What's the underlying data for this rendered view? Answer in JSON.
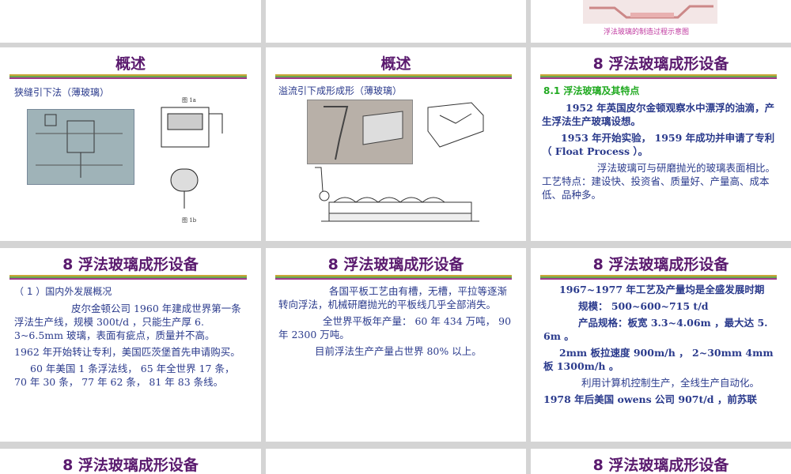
{
  "top_caption": "浮法玻璃的制造过程示意图",
  "slides": {
    "s1": {
      "title": "概述",
      "subtitle": "狭缝引下法（薄玻璃）",
      "fig_a": "图 1a",
      "fig_b": "图 1b"
    },
    "s2": {
      "title": "概述",
      "subtitle": "溢流引下成形成形（薄玻璃）"
    },
    "s3": {
      "title": "8  浮法玻璃成形设备",
      "heading": "8.1   浮法玻璃及其特点",
      "p1": "1952 年英国皮尔金顿观察水中漂浮的油滴，产生浮法生产玻璃设想。",
      "p2": "1953 年开始实验， 1959 年成功并申请了专利（ Float Process ）。",
      "p3": "浮法玻璃可与研磨抛光的玻璃表面相比。工艺特点：建设快、投资省、质量好、产量高、成本低、品种多。"
    },
    "s4": {
      "title": "8  浮法玻璃成形设备",
      "heading": "（ 1 ）国内外发展概况",
      "p1": "皮尔金顿公司 1960 年建成世界第一条浮法生产线，规模 300t/d ，只能生产厚 6. 3~6.5mm 玻璃，表面有疵点，质量并不高。",
      "p2": "1962 年开始转让专利，美国匹茨堡首先申请购买。",
      "p3": "60 年美国 1 条浮法线， 65 年全世界 17 条， 70 年 30 条， 77 年 62 条， 81 年 83 条线。"
    },
    "s5": {
      "title": "8  浮法玻璃成形设备",
      "p1": "各国平板工艺由有槽，无槽，平拉等逐渐转向浮法，机械研磨抛光的平板线几乎全部消失。",
      "p2": "全世界平板年产量： 60 年 434 万吨， 90 年 2300 万吨。",
      "p3": "目前浮法生产产量占世界 80% 以上。"
    },
    "s6": {
      "title": "8  浮法玻璃成形设备",
      "p1": "1967~1977 年工艺及产量均是全盛发展时期",
      "p2": "规模： 500~600~715 t/d",
      "p3": "产品规格：板宽 3.3~4.06m ，最大达 5. 6m 。",
      "p4": "2mm 板拉速度 900m/h ，   2~30mm 4mm 板 1300m/h 。",
      "p5": "利用计算机控制生产，全线生产自动化。",
      "p6": "1978 年后美国 owens 公司 907t/d ，前苏联"
    },
    "s7": {
      "title": "8  浮法玻璃成形设备"
    },
    "s9": {
      "title": "8  浮法玻璃成形设备"
    }
  },
  "colors": {
    "title": "#5a1a6e",
    "text": "#2a3a8c",
    "heading_green": "#22aa22",
    "caption": "#c03aa0"
  }
}
